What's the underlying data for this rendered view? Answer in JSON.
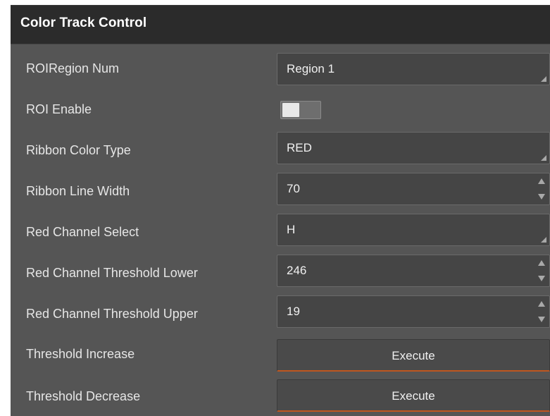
{
  "panel": {
    "title": "Color Track Control"
  },
  "rows": [
    {
      "label": "ROIRegion Num",
      "control": "dropdown",
      "value": "Region 1"
    },
    {
      "label": "ROI Enable",
      "control": "toggle",
      "value": "off"
    },
    {
      "label": "Ribbon Color Type",
      "control": "dropdown",
      "value": "RED"
    },
    {
      "label": "Ribbon Line Width",
      "control": "spinbox",
      "value": "70"
    },
    {
      "label": "Red Channel Select",
      "control": "dropdown",
      "value": "H"
    },
    {
      "label": "Red Channel Threshold Lower",
      "control": "spinbox",
      "value": "246"
    },
    {
      "label": "Red Channel Threshold Upper",
      "control": "spinbox",
      "value": "19"
    },
    {
      "label": "Threshold Increase",
      "control": "button",
      "value": "Execute"
    },
    {
      "label": "Threshold Decrease",
      "control": "button",
      "value": "Execute"
    }
  ],
  "colors": {
    "panel_bg": "#555555",
    "header_bg": "#2b2b2b",
    "field_bg": "#454545",
    "button_accent": "#c0571f"
  },
  "icons": {
    "dropdown": "dropdown-corner-icon",
    "spin_up": "spin-up-icon",
    "spin_down": "spin-down-icon"
  }
}
